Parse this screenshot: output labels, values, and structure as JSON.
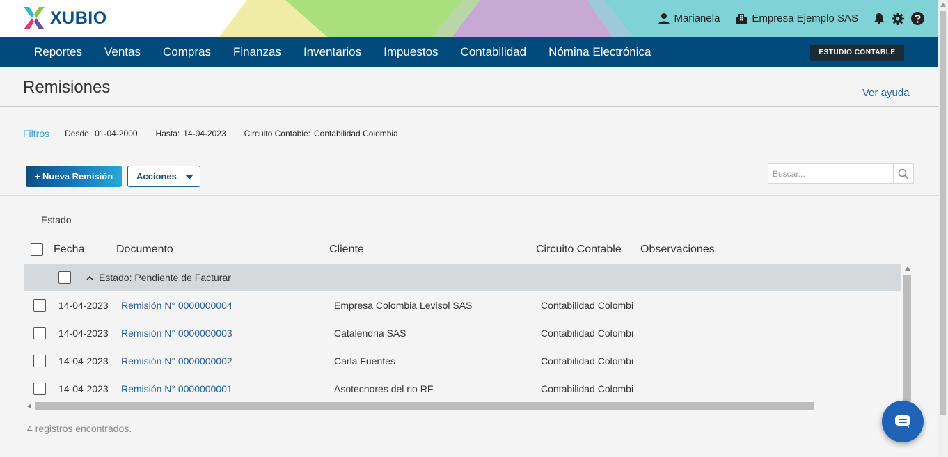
{
  "header": {
    "brand": "XUBIO",
    "user": "Marianela",
    "company": "Empresa Ejemplo SAS",
    "icons": [
      "user-icon",
      "building-icon",
      "bell-icon",
      "gear-icon",
      "help-icon"
    ]
  },
  "nav": {
    "items": [
      "Reportes",
      "Ventas",
      "Compras",
      "Finanzas",
      "Inventarios",
      "Impuestos",
      "Contabilidad",
      "Nómina Electrónica"
    ],
    "studio_button": "ESTUDIO CONTABLE"
  },
  "page": {
    "title": "Remisiones",
    "help_link": "Ver ayuda"
  },
  "filters": {
    "label": "Filtros",
    "desde_label": "Desde:",
    "desde_value": "01-04-2000",
    "hasta_label": "Hasta:",
    "hasta_value": "14-04-2023",
    "circuito_label": "Circuito Contable:",
    "circuito_value": "Contabilidad Colombia"
  },
  "toolbar": {
    "new_button": "+ Nueva Remisión",
    "actions_button": "Acciones",
    "search_placeholder": "Buscar..."
  },
  "grid": {
    "group_by_label": "Estado",
    "columns": [
      "Fecha",
      "Documento",
      "Cliente",
      "Circuito Contable",
      "Observaciones"
    ],
    "group_label": "Estado: Pendiente de Facturar",
    "rows": [
      {
        "fecha": "14-04-2023",
        "documento": "Remisión N° 0000000004",
        "cliente": "Empresa Colombia Levisol SAS",
        "circuito": "Contabilidad Colombi",
        "observaciones": ""
      },
      {
        "fecha": "14-04-2023",
        "documento": "Remisión N° 0000000003",
        "cliente": "Catalendria SAS",
        "circuito": "Contabilidad Colombi",
        "observaciones": ""
      },
      {
        "fecha": "14-04-2023",
        "documento": "Remisión N° 0000000002",
        "cliente": "Carla Fuentes",
        "circuito": "Contabilidad Colombi",
        "observaciones": ""
      },
      {
        "fecha": "14-04-2023",
        "documento": "Remisión N° 0000000001",
        "cliente": "Asotecnores del rio RF",
        "circuito": "Contabilidad Colombi",
        "observaciones": ""
      }
    ],
    "records_text": "4 registros encontrados."
  },
  "colors": {
    "nav_bg": "#004a7c",
    "link": "#1f5f99",
    "accent_light": "#3a9bd1",
    "group_row_bg": "#d6d9dc",
    "chat_button": "#1e63b5"
  }
}
